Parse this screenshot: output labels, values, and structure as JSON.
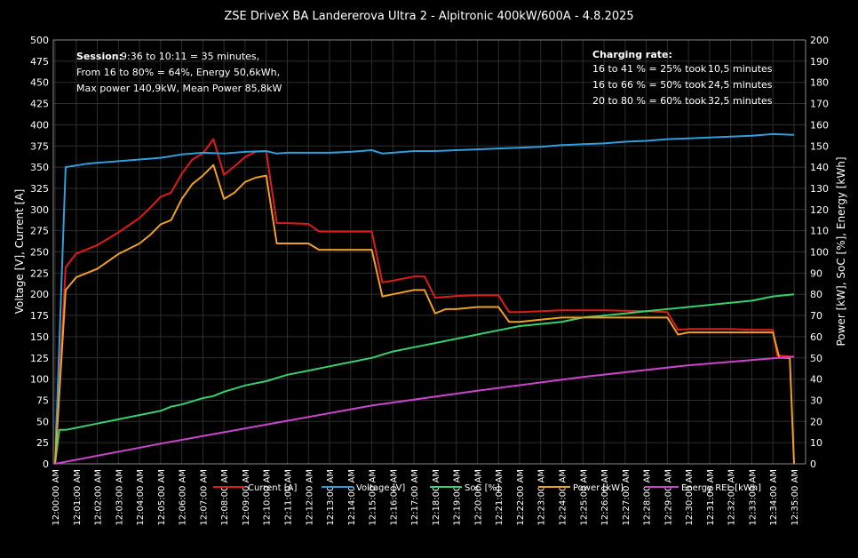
{
  "chart_data": {
    "type": "line",
    "title": "ZSE DriveX BA Landererova Ultra 2 - Alpitronic 400kW/600A - 4.8.2025",
    "ylabel_left": "Voltage [V], Current [A]",
    "ylabel_right": "Power [kW], SoC [%], Energy [kWh]",
    "ylim_left": [
      0,
      500
    ],
    "ylim_right": [
      0,
      200
    ],
    "yticks_left": [
      "0",
      "25",
      "50",
      "75",
      "100",
      "125",
      "150",
      "175",
      "200",
      "225",
      "250",
      "275",
      "300",
      "325",
      "350",
      "375",
      "400",
      "425",
      "450",
      "475",
      "500"
    ],
    "yticks_right": [
      "0",
      "10",
      "20",
      "30",
      "40",
      "50",
      "60",
      "70",
      "80",
      "90",
      "100",
      "110",
      "120",
      "130",
      "140",
      "150",
      "160",
      "170",
      "180",
      "190",
      "200"
    ],
    "xlim": [
      0,
      35.5
    ],
    "xticks": [
      "12:00:00 AM",
      "12:01:00 AM",
      "12:02:00 AM",
      "12:03:00 AM",
      "12:04:00 AM",
      "12:05:00 AM",
      "12:06:00 AM",
      "12:07:00 AM",
      "12:08:00 AM",
      "12:09:00 AM",
      "12:10:00 AM",
      "12:11:00 AM",
      "12:12:00 AM",
      "12:13:00 AM",
      "12:14:00 AM",
      "12:15:00 AM",
      "12:16:00 AM",
      "12:17:00 AM",
      "12:18:00 AM",
      "12:19:00 AM",
      "12:20:00 AM",
      "12:21:00 AM",
      "12:22:00 AM",
      "12:23:00 AM",
      "12:24:00 AM",
      "12:25:00 AM",
      "12:26:00 AM",
      "12:27:00 AM",
      "12:28:00 AM",
      "12:29:00 AM",
      "12:30:00 AM",
      "12:31:00 AM",
      "12:32:00 AM",
      "12:33:00 AM",
      "12:34:00 AM",
      "12:35:00 AM"
    ],
    "grid": true,
    "legend_position": "bottom",
    "session_label": "Session:",
    "session_lines": [
      "9:36 to 10:11 = 35 minutes,",
      "From 16 to 80% = 64%, Energy 50,6kWh,",
      "Max power 140,9kW, Mean Power 85,8kW"
    ],
    "rate_title": "Charging rate:",
    "rate_lines": [
      {
        "range": "16 to 41 % = 25% took",
        "time": "10,5 minutes"
      },
      {
        "range": "16 to 66 % = 50% took",
        "time": "24,5 minutes"
      },
      {
        "range": "20 to 80 % = 60% took",
        "time": "32,5 minutes"
      }
    ],
    "series": [
      {
        "name": "Current [A]",
        "axis": "left",
        "color": "#e01a1a",
        "x": [
          0,
          0.5,
          1,
          2,
          3,
          4,
          4.5,
          5,
          5.5,
          6,
          6.5,
          7,
          7.5,
          8,
          8.5,
          9,
          9.5,
          10,
          10.5,
          11,
          12,
          12.5,
          13,
          15,
          15.5,
          16,
          17,
          17.5,
          18,
          18.5,
          19,
          20,
          21,
          21.5,
          22,
          23,
          24,
          26,
          28,
          29,
          29.5,
          30,
          31,
          32,
          33,
          34,
          34.2,
          34.6,
          35
        ],
        "y": [
          0,
          232,
          248,
          258,
          273,
          290,
          302,
          315,
          320,
          342,
          359,
          366,
          383,
          341,
          351,
          362,
          368,
          369,
          284,
          284,
          283,
          274,
          274,
          274,
          214,
          216,
          221,
          221,
          196,
          197,
          198,
          199,
          199,
          179,
          179,
          180,
          181,
          181,
          180,
          179,
          158,
          159,
          159,
          159,
          158,
          158,
          128,
          127,
          126
        ]
      },
      {
        "name": "Voltage [V]",
        "axis": "left",
        "color": "#2e9fdc",
        "x": [
          0,
          0.5,
          1,
          1.5,
          2,
          3,
          4,
          5,
          6,
          7,
          8,
          9,
          10,
          10.5,
          11,
          12,
          13,
          14,
          15,
          15.5,
          16,
          17,
          18,
          19,
          20,
          21,
          22,
          23,
          24,
          25,
          26,
          27,
          28,
          29,
          30,
          31,
          32,
          33,
          34,
          35
        ],
        "y": [
          0,
          350,
          352,
          354,
          355,
          357,
          359,
          361,
          365,
          367,
          366,
          368,
          369,
          366,
          367,
          367,
          367,
          368,
          370,
          366,
          367,
          369,
          369,
          370,
          371,
          372,
          373,
          374,
          376,
          377,
          378,
          380,
          381,
          383,
          384,
          385,
          386,
          387,
          389,
          388
        ]
      },
      {
        "name": "SoC [%]",
        "axis": "right",
        "color": "#36d16f",
        "x": [
          0,
          0.2,
          0.5,
          1,
          2,
          3,
          4,
          5,
          5.5,
          6,
          7,
          7.5,
          8,
          9,
          10,
          11,
          12,
          13,
          14,
          15,
          16,
          17,
          18,
          19,
          20,
          21,
          22,
          23,
          24,
          25,
          26,
          27,
          28,
          29,
          30,
          31,
          32,
          33,
          34,
          35
        ],
        "y": [
          0,
          16,
          16,
          17,
          19,
          21,
          23,
          25,
          27,
          28,
          31,
          32,
          34,
          37,
          39,
          42,
          44,
          46,
          48,
          50,
          53,
          55,
          57,
          59,
          61,
          63,
          65,
          66,
          67,
          69,
          70,
          71,
          72,
          73,
          74,
          75,
          76,
          77,
          79,
          80
        ]
      },
      {
        "name": "Power [kW]",
        "axis": "right",
        "color": "#f0a020",
        "x": [
          0,
          0.5,
          1,
          2,
          3,
          4,
          4.5,
          5,
          5.5,
          6,
          6.5,
          7,
          7.5,
          8,
          8.5,
          9,
          9.5,
          10,
          10.5,
          11,
          12,
          12.5,
          13,
          15,
          15.5,
          16,
          17,
          17.5,
          18,
          18.5,
          19,
          20,
          21,
          21.5,
          22,
          23,
          24,
          26,
          28,
          29,
          29.5,
          30,
          31,
          32,
          33,
          34,
          34.3,
          34.8,
          35
        ],
        "y": [
          0,
          82,
          88,
          92,
          99,
          104,
          108,
          113,
          115,
          125,
          132,
          136,
          141,
          125,
          128,
          133,
          135,
          136,
          104,
          104,
          104,
          101,
          101,
          101,
          79,
          80,
          82,
          82,
          71,
          73,
          73,
          74,
          74,
          67,
          67,
          68,
          69,
          69,
          69,
          69,
          61,
          62,
          62,
          62,
          62,
          62,
          50,
          50,
          0
        ]
      },
      {
        "name": "Energy REL [kWh]",
        "axis": "right",
        "color": "#cc44cc",
        "x": [
          0,
          5,
          10,
          15,
          20,
          25,
          30,
          35
        ],
        "y": [
          0,
          9.5,
          18.5,
          27.5,
          34.5,
          41,
          46.5,
          50.6
        ]
      }
    ]
  }
}
